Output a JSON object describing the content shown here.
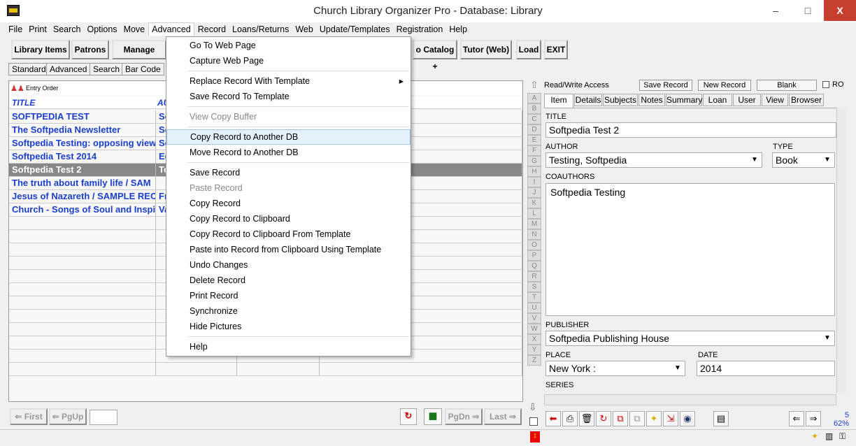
{
  "window": {
    "title": "Church Library Organizer Pro - Database: Library",
    "min": "–",
    "max": "□",
    "close": "X"
  },
  "menubar": [
    "File",
    "Print",
    "Search",
    "Options",
    "Move",
    "Advanced",
    "Record",
    "Loans/Returns",
    "Web",
    "Update/Templates",
    "Registration",
    "Help"
  ],
  "toolbar": [
    "Library Items",
    "Patrons",
    "Manage Loan",
    "o Catalog +",
    "Tutor (Web)",
    "Load",
    "EXIT"
  ],
  "view_tabs": [
    "Standard",
    "Advanced",
    "Search",
    "Bar Code"
  ],
  "grid": {
    "sort_label": "Entry Order",
    "header": [
      "TITLE",
      "AU"
    ],
    "rows": [
      [
        "SOFTPEDIA TEST",
        "So"
      ],
      [
        "The Softpedia Newsletter",
        "So"
      ],
      [
        "Softpedia Testing: opposing view",
        "So"
      ],
      [
        "Softpedia Test 2014",
        "Ed"
      ],
      [
        "Softpedia Test 2",
        "Te"
      ],
      [
        "The truth about family life / SAM",
        ""
      ],
      [
        "Jesus of Nazareth / SAMPLE REC",
        "Fr"
      ],
      [
        "Church - Songs of Soul and Inspi",
        "Va"
      ]
    ],
    "selected_row": 4
  },
  "alphabet": [
    "A",
    "B",
    "C",
    "D",
    "E",
    "F",
    "G",
    "H",
    "I",
    "J",
    "K",
    "L",
    "M",
    "N",
    "O",
    "P",
    "Q",
    "R",
    "S",
    "T",
    "U",
    "V",
    "W",
    "X",
    "Y",
    "Z"
  ],
  "record": {
    "access": "Read/Write Access",
    "save": "Save Record",
    "new": "New Record",
    "blank": "Blank",
    "ro": "RO",
    "tabs": [
      "Item",
      "Details",
      "Subjects",
      "Notes",
      "Summary",
      "Loan",
      "User",
      "View",
      "Browser"
    ],
    "title_label": "TITLE",
    "title": "Softpedia Test 2",
    "author_label": "AUTHOR",
    "author": "Testing, Softpedia",
    "type_label": "TYPE",
    "type": "Book",
    "coauthors_label": "COAUTHORS",
    "coauthors": "Softpedia Testing",
    "publisher_label": "PUBLISHER",
    "publisher": "Softpedia Publishing House",
    "place_label": "PLACE",
    "place": "New York :",
    "date_label": "DATE",
    "date": "2014",
    "series_label": "SERIES"
  },
  "menu": {
    "items": [
      {
        "label": "Go To Web Page",
        "state": "normal"
      },
      {
        "label": "Capture Web Page",
        "state": "normal"
      },
      {
        "sep": true
      },
      {
        "label": "Replace Record With Template",
        "state": "normal",
        "submenu": true
      },
      {
        "label": "Save Record To Template",
        "state": "normal"
      },
      {
        "sep": true
      },
      {
        "label": "View Copy Buffer",
        "state": "disabled"
      },
      {
        "sep": true
      },
      {
        "label": "Copy Record to Another DB",
        "state": "highlight"
      },
      {
        "label": "Move Record to Another DB",
        "state": "normal"
      },
      {
        "sep": true
      },
      {
        "label": "Save Record",
        "state": "normal"
      },
      {
        "label": "Paste Record",
        "state": "disabled"
      },
      {
        "label": "Copy Record",
        "state": "normal"
      },
      {
        "label": "Copy Record to Clipboard",
        "state": "normal"
      },
      {
        "label": "Copy Record to Clipboard From Template",
        "state": "normal"
      },
      {
        "label": "Paste into Record from Clipboard Using Template",
        "state": "normal"
      },
      {
        "label": "Undo Changes",
        "state": "normal"
      },
      {
        "label": "Delete Record",
        "state": "normal"
      },
      {
        "label": "Print Record",
        "state": "normal"
      },
      {
        "label": "Synchronize",
        "state": "normal"
      },
      {
        "label": "Hide Pictures",
        "state": "normal"
      },
      {
        "sep": true
      },
      {
        "label": "Help",
        "state": "normal"
      }
    ]
  },
  "nav": {
    "first": "First",
    "pgup": "PgUp",
    "pgdn": "PgDn",
    "last": "Last"
  },
  "status": {
    "page": "5",
    "zoom": "62%"
  }
}
